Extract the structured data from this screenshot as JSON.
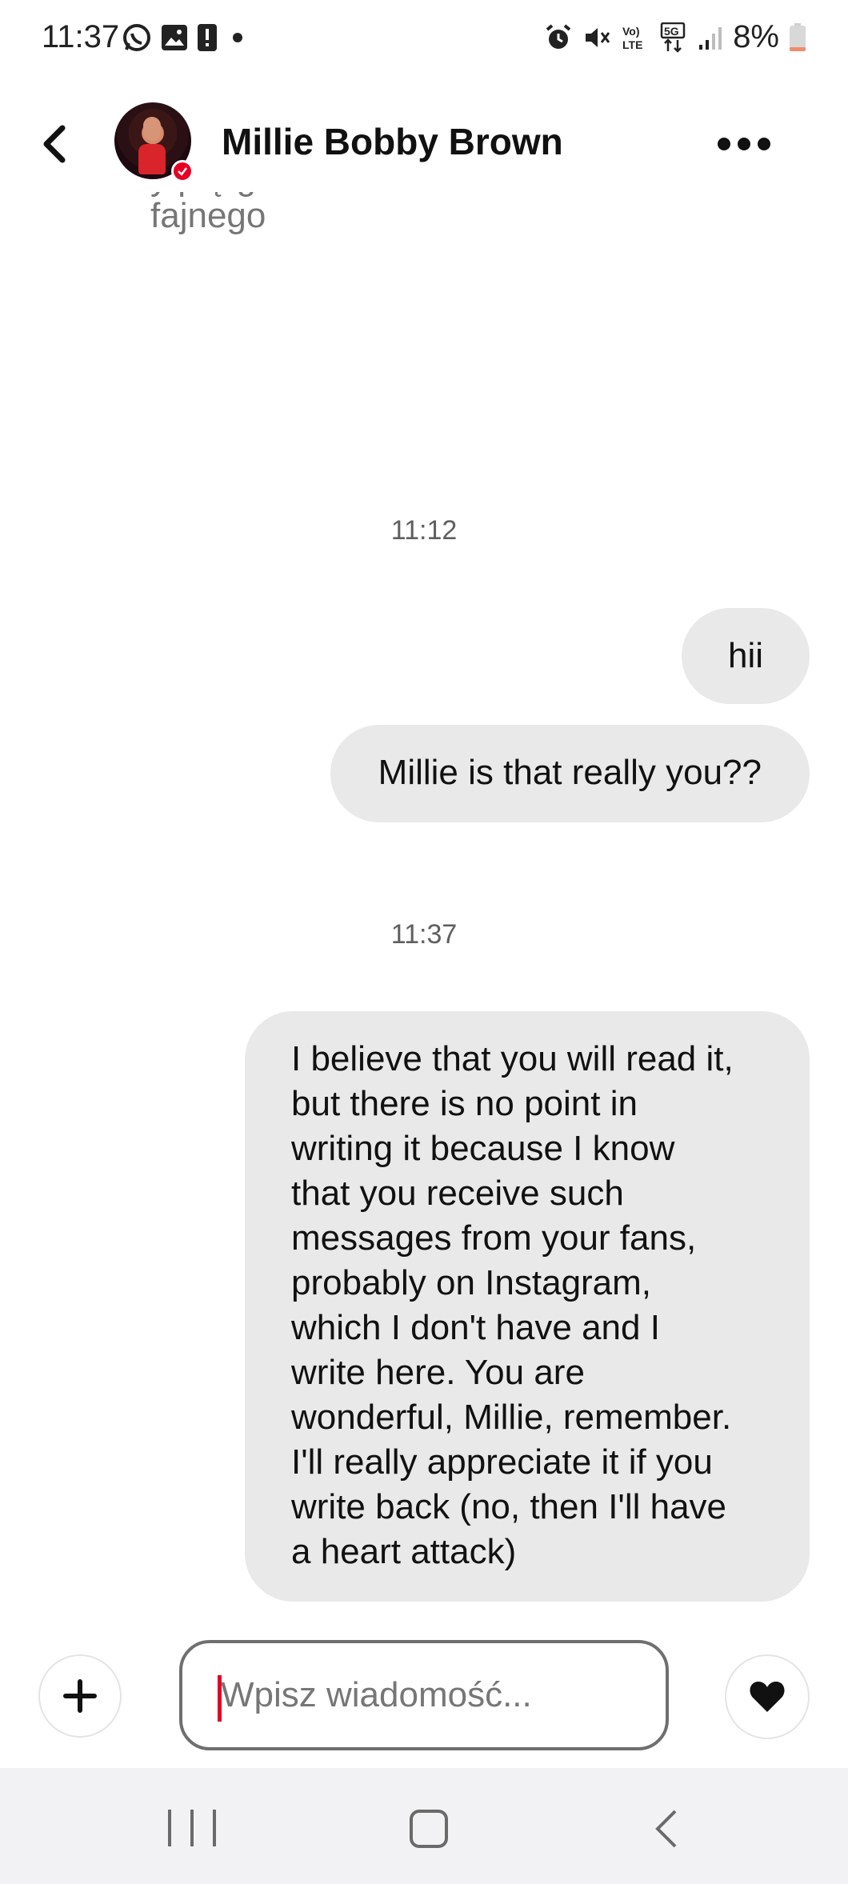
{
  "status_bar": {
    "time": "11:37",
    "battery_percent": "8%",
    "left_icons": [
      "whatsapp-icon",
      "gallery-icon",
      "alert-icon",
      "dot-icon"
    ],
    "right_icons": [
      "alarm-icon",
      "mute-icon",
      "volte-icon",
      "5g-icon",
      "signal-icon",
      "battery-icon"
    ],
    "battery_color": "#f28b6b"
  },
  "header": {
    "contact_name": "Millie Bobby Brown",
    "verified_color": "#e60023"
  },
  "chat": {
    "partial_previous_message": "fajnego",
    "partial_cut_line": "y   p   ę        g",
    "timestamp_1": "11:12",
    "messages_group_1": [
      "hii",
      "Millie is that really you??"
    ],
    "timestamp_2": "11:37",
    "long_message": "I believe that you will read it,\nbut there is no point in\nwriting it because I know\nthat you receive such\nmessages from your fans,\nprobably on Instagram,\nwhich I don't have and I\nwrite here. You are\nwonderful, Millie, remember.\nI'll really appreciate it if you\nwrite back (no, then I'll have\na heart attack)"
  },
  "composer": {
    "placeholder": "Wpisz wiadomość...",
    "value": "",
    "accent_color": "#e60023"
  }
}
